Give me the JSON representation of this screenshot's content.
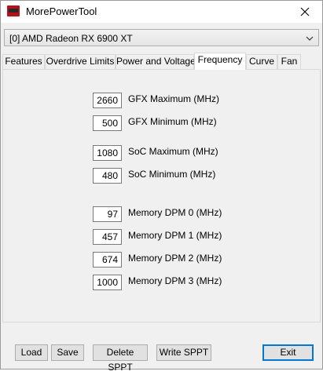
{
  "window": {
    "title": "MorePowerTool"
  },
  "gpu_select": {
    "value": "[0] AMD Radeon RX 6900 XT"
  },
  "tabs": [
    {
      "label": "Features"
    },
    {
      "label": "Overdrive Limits"
    },
    {
      "label": "Power and Voltage"
    },
    {
      "label": "Frequency",
      "active": true
    },
    {
      "label": "Curve"
    },
    {
      "label": "Fan"
    }
  ],
  "frequency": {
    "gfx_max": {
      "value": "2660",
      "label": "GFX Maximum (MHz)"
    },
    "gfx_min": {
      "value": "500",
      "label": "GFX Minimum (MHz)"
    },
    "soc_max": {
      "value": "1080",
      "label": "SoC Maximum (MHz)"
    },
    "soc_min": {
      "value": "480",
      "label": "SoC Minimum (MHz)"
    },
    "mem_dpm0": {
      "value": "97",
      "label": "Memory DPM 0 (MHz)"
    },
    "mem_dpm1": {
      "value": "457",
      "label": "Memory DPM 1 (MHz)"
    },
    "mem_dpm2": {
      "value": "674",
      "label": "Memory DPM 2 (MHz)"
    },
    "mem_dpm3": {
      "value": "1000",
      "label": "Memory DPM 3 (MHz)"
    }
  },
  "buttons": {
    "load": "Load",
    "save": "Save",
    "delete_sppt": "Delete SPPT",
    "write_sppt": "Write SPPT",
    "exit": "Exit"
  },
  "icons": {
    "app": "amd-logo-icon",
    "close": "close-icon",
    "dropdown": "chevron-down-icon"
  }
}
